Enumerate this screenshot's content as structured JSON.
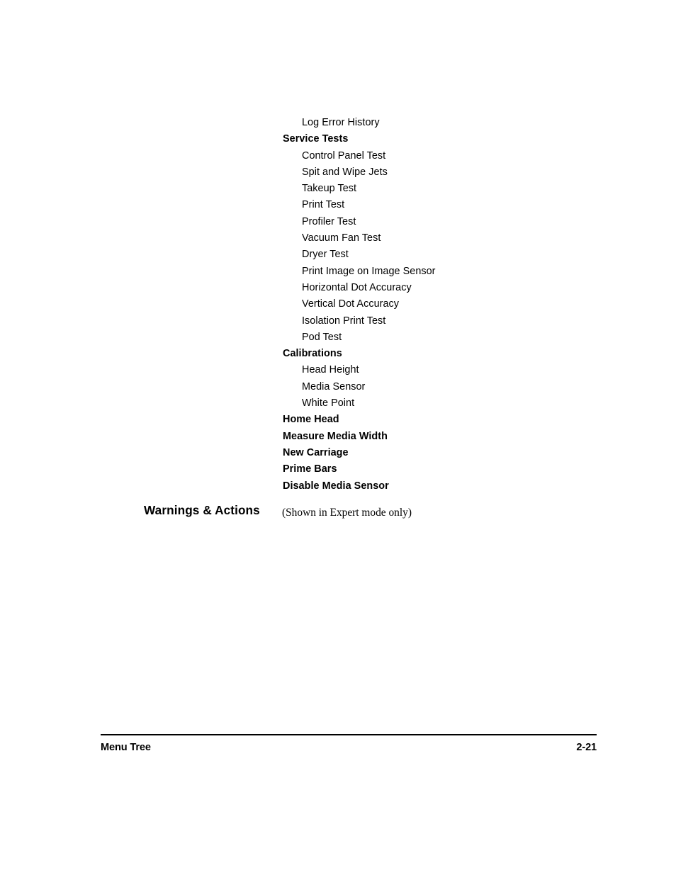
{
  "menu_tree": {
    "items": [
      {
        "label": "Log Error History",
        "level": 2
      },
      {
        "label": "Service Tests",
        "level": 1
      },
      {
        "label": "Control Panel Test",
        "level": 2
      },
      {
        "label": "Spit and Wipe Jets",
        "level": 2
      },
      {
        "label": "Takeup Test",
        "level": 2
      },
      {
        "label": "Print Test",
        "level": 2
      },
      {
        "label": "Profiler Test",
        "level": 2
      },
      {
        "label": "Vacuum Fan Test",
        "level": 2
      },
      {
        "label": "Dryer Test",
        "level": 2
      },
      {
        "label": "Print Image on Image Sensor",
        "level": 2
      },
      {
        "label": "Horizontal Dot Accuracy",
        "level": 2
      },
      {
        "label": "Vertical Dot Accuracy",
        "level": 2
      },
      {
        "label": "Isolation Print Test",
        "level": 2
      },
      {
        "label": "Pod Test",
        "level": 2
      },
      {
        "label": "Calibrations",
        "level": 1
      },
      {
        "label": "Head Height",
        "level": 2
      },
      {
        "label": "Media Sensor",
        "level": 2
      },
      {
        "label": "White Point",
        "level": 2
      },
      {
        "label": "Home Head",
        "level": 1
      },
      {
        "label": "Measure Media Width",
        "level": 1
      },
      {
        "label": "New Carriage",
        "level": 1
      },
      {
        "label": "Prime Bars",
        "level": 1
      },
      {
        "label": "Disable Media Sensor",
        "level": 1
      }
    ]
  },
  "section": {
    "heading": "Warnings & Actions",
    "note": "(Shown in Expert mode only)"
  },
  "footer": {
    "chapter_title": "Menu Tree",
    "page_number": "2-21"
  }
}
